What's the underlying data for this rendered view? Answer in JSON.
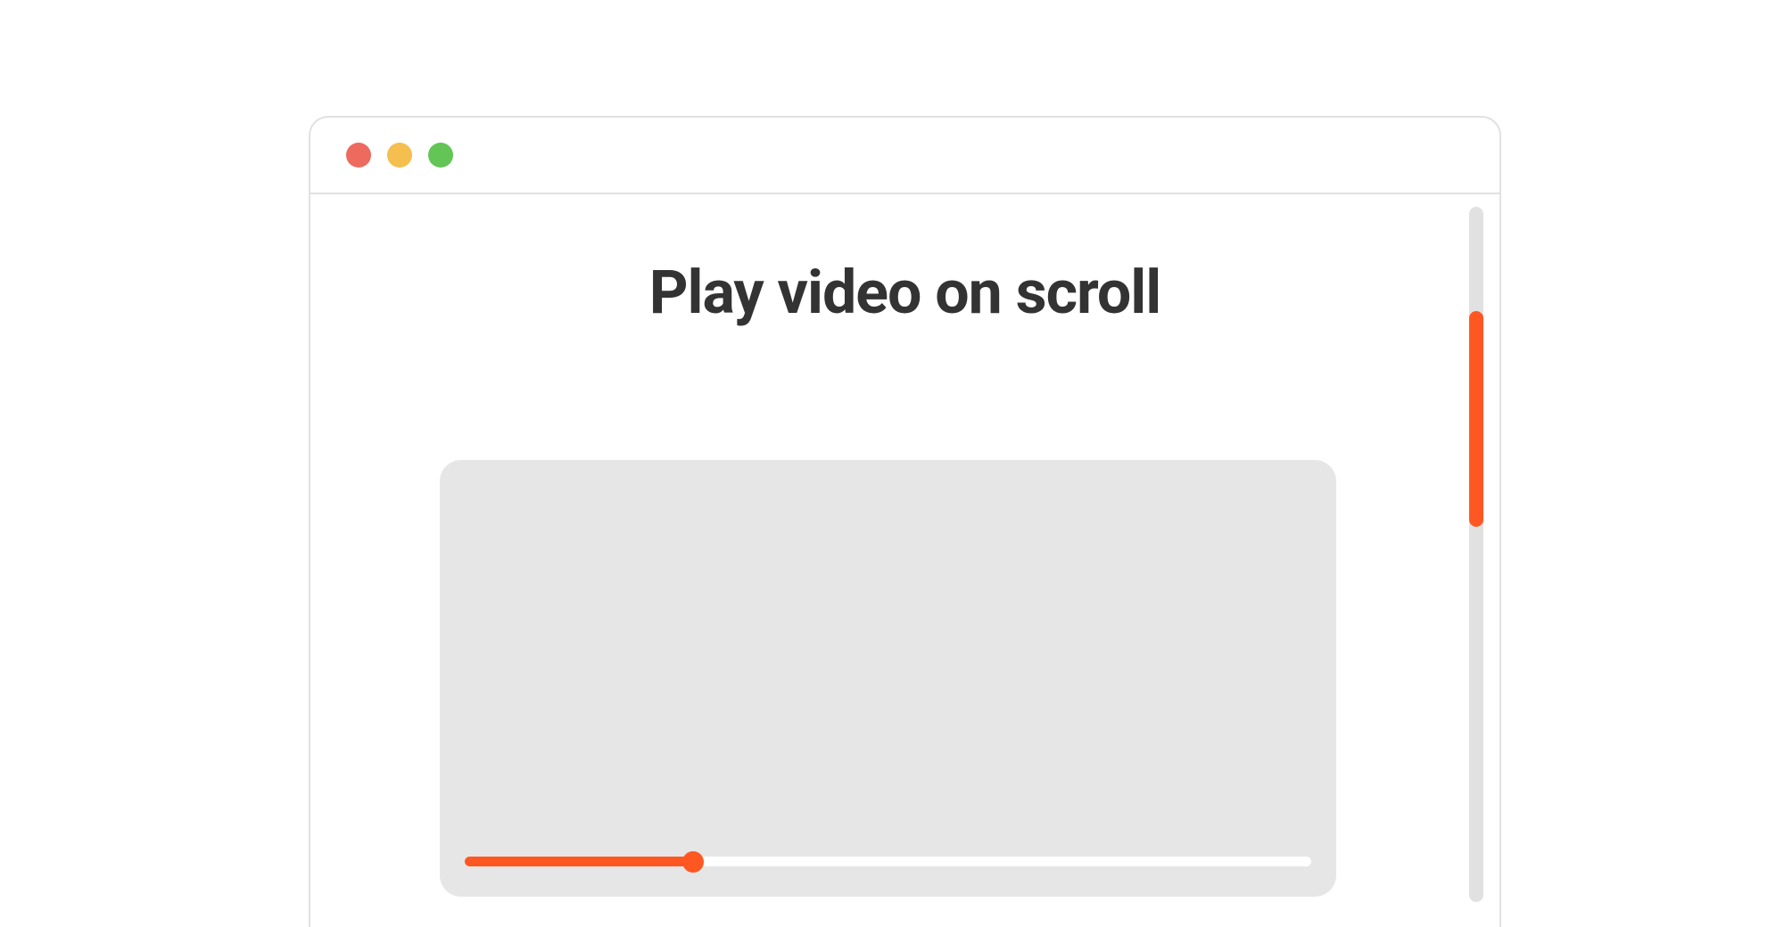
{
  "window": {
    "traffic_lights": {
      "close_color": "#ed6a5e",
      "minimize_color": "#f5bf4f",
      "maximize_color": "#62c555"
    }
  },
  "content": {
    "heading": "Play video on scroll"
  },
  "video": {
    "progress_percent": 27
  },
  "scrollbar": {
    "thumb_top_percent": 15,
    "thumb_height_percent": 31
  },
  "colors": {
    "accent": "#ff5722",
    "placeholder": "#e6e6e6",
    "border": "#e1e1e1",
    "text": "#333333"
  }
}
